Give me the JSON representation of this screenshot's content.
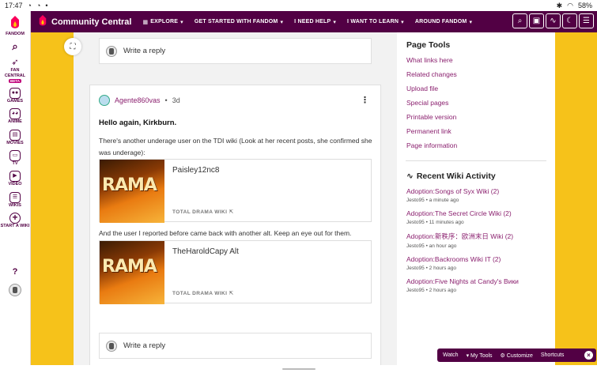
{
  "statusbar": {
    "time": "17:47",
    "battery": "58%"
  },
  "rail": {
    "items": [
      {
        "label": "FANDOM"
      },
      {
        "label": "FAN CENTRAL",
        "badge": "BETA"
      },
      {
        "label": "GAMES"
      },
      {
        "label": "ANIME"
      },
      {
        "label": "MOVIES"
      },
      {
        "label": "TV"
      },
      {
        "label": "VIDEO"
      },
      {
        "label": "WIKIS"
      },
      {
        "label": "START A WIKI"
      }
    ]
  },
  "topbar": {
    "brand": "Community Central",
    "nav": [
      "EXPLORE",
      "GET STARTED WITH FANDOM",
      "I NEED HELP",
      "I WANT TO LEARN",
      "AROUND FANDOM"
    ]
  },
  "thread": {
    "reply_placeholder": "Write a reply",
    "post": {
      "user": "Agente860vas",
      "time": "3d",
      "heading": "Hello again, Kirkburn.",
      "para1": "There's another underage user on the TDI wiki (Look at her recent posts, she confirmed she was underage):",
      "embed1": {
        "title": "Paisley12nc8",
        "source": "TOTAL DRAMA WIKI"
      },
      "para2": "And the user I reported before came back with another alt. Keep an eye out for them.",
      "embed2": {
        "title": "TheHaroldCapy Alt",
        "source": "TOTAL DRAMA WIKI"
      },
      "thumb_text": "RAMA"
    }
  },
  "sidebar": {
    "page_tools_title": "Page Tools",
    "page_tools": [
      "What links here",
      "Related changes",
      "Upload file",
      "Special pages",
      "Printable version",
      "Permanent link",
      "Page information"
    ],
    "recent_title": "Recent Wiki Activity",
    "recent": [
      {
        "title": "Adoption:Songs of Syx Wiki (2)",
        "meta": "Jesto95 • a minute ago"
      },
      {
        "title": "Adoption:The Secret Circle Wiki (2)",
        "meta": "Jesto95 • 11 minutes ago"
      },
      {
        "title": "Adoption:新秩序：欧洲末日 Wiki (2)",
        "meta": "Jesto95 • an hour ago"
      },
      {
        "title": "Adoption:Backrooms Wiki IT (2)",
        "meta": "Jesto95 • 2 hours ago"
      },
      {
        "title": "Adoption:Five Nights at Candy's Вики",
        "meta": "Jesto95 • 2 hours ago"
      }
    ]
  },
  "toolbar": {
    "watch": "Watch",
    "my_tools": "My Tools",
    "customize": "Customize",
    "shortcuts": "Shortcuts"
  },
  "colors": {
    "brand": "#520044",
    "link": "#8a1f6e",
    "background": "#f6c21a"
  }
}
